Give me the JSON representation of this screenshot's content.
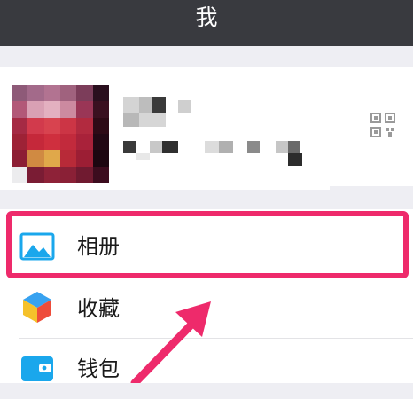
{
  "navbar": {
    "title": "我"
  },
  "menu": {
    "items": [
      {
        "label": "相册",
        "icon": "photo-album-icon"
      },
      {
        "label": "收藏",
        "icon": "favorites-cube-icon"
      },
      {
        "label": "钱包",
        "icon": "wallet-icon"
      }
    ]
  },
  "colors": {
    "navbar": "#393a3f",
    "background": "#eeeef3",
    "highlight": "#ee2a6b",
    "album_icon": "#1aa7ec"
  }
}
